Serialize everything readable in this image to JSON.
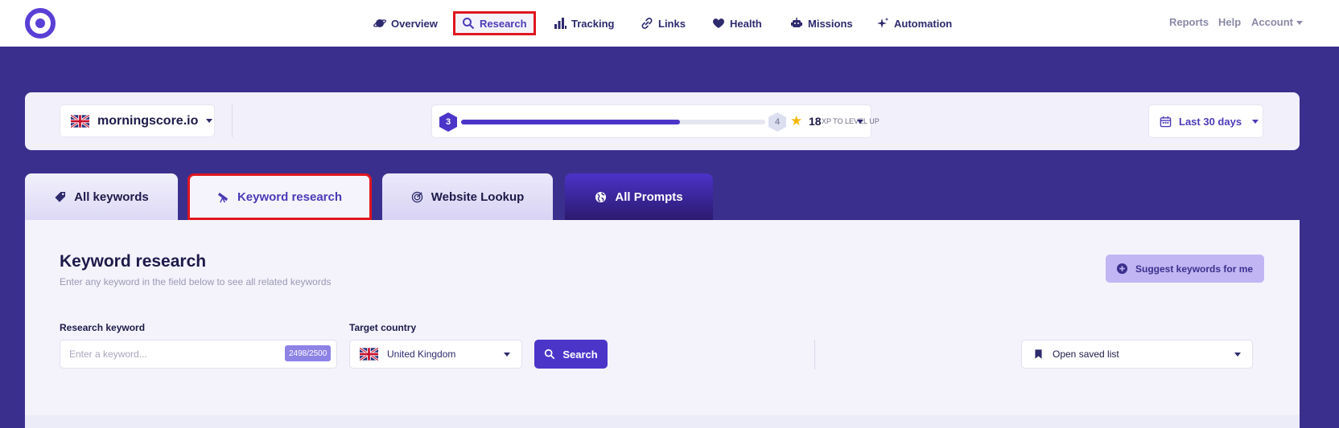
{
  "nav": {
    "items": [
      {
        "label": "Overview",
        "icon": "planet-icon"
      },
      {
        "label": "Research",
        "icon": "search-icon"
      },
      {
        "label": "Tracking",
        "icon": "bar-chart-icon"
      },
      {
        "label": "Links",
        "icon": "link-icon"
      },
      {
        "label": "Health",
        "icon": "heart-icon"
      },
      {
        "label": "Missions",
        "icon": "robot-icon"
      },
      {
        "label": "Automation",
        "icon": "sparkle-icon"
      }
    ],
    "active": "Research",
    "right": {
      "reports": "Reports",
      "help": "Help",
      "account": "Account"
    }
  },
  "site": {
    "domain": "morningscore.io",
    "level": "3",
    "next_level": "4",
    "xp_progress": 0.72,
    "xp": "18",
    "xp_label": "XP TO LEVEL UP",
    "date_range": "Last 30 days"
  },
  "tabs": [
    {
      "label": "All keywords",
      "icon": "tag-icon"
    },
    {
      "label": "Keyword research",
      "icon": "telescope-icon"
    },
    {
      "label": "Website Lookup",
      "icon": "radar-icon"
    },
    {
      "label": "All Prompts",
      "icon": "globe-icon"
    }
  ],
  "main": {
    "title": "Keyword research",
    "subtitle": "Enter any keyword in the field below to see all related keywords",
    "suggest_button": "Suggest keywords for me",
    "keyword_label": "Research keyword",
    "keyword_placeholder": "Enter a keyword...",
    "quota": "2498/2500",
    "country_label": "Target country",
    "country": "United Kingdom",
    "search_button": "Search",
    "saved_list": "Open saved list"
  },
  "colors": {
    "brand": "#4b35c9",
    "background": "#3b2f8e",
    "highlight": "#e0161e"
  }
}
